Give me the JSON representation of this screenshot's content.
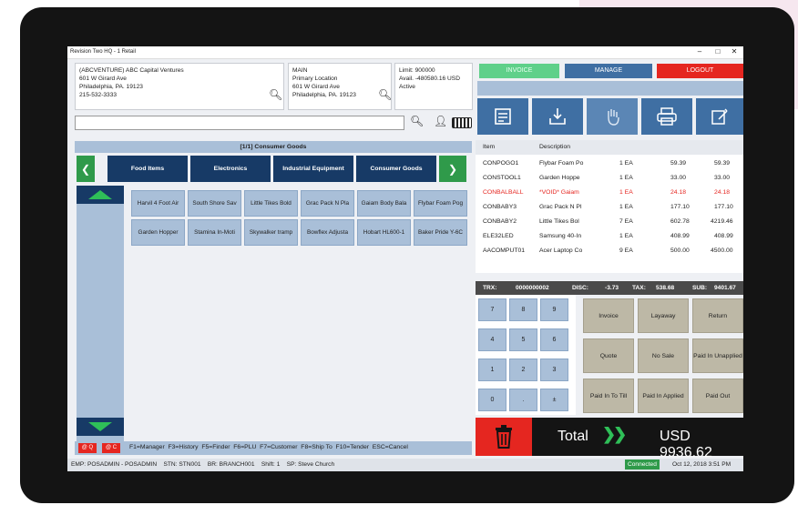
{
  "window": {
    "title": "Revision Two HQ - 1 Retail"
  },
  "customer": {
    "line1": "(ABCVENTURE) ABC Capital Ventures",
    "line2": "601 W Girard Ave",
    "line3": "Philadelphia, PA. 19123",
    "line4": "215-532-3333"
  },
  "location": {
    "line1": "MAIN",
    "line2": "Primary Location",
    "line3": "601 W Girard Ave",
    "line4": "Philadelphia, PA. 19123"
  },
  "credit": {
    "line1": "Limit: 900000",
    "line2": "Avail. -480580.16 USD",
    "line3": "Active"
  },
  "top_buttons": {
    "invoice": "INVOICE",
    "manage": "MANAGE",
    "logout": "LOGOUT"
  },
  "category": {
    "header": "[1/1] Consumer Goods",
    "tabs": [
      "Food Items",
      "Electronics",
      "Industrial Equipment",
      "Consumer Goods"
    ]
  },
  "products": [
    "Harvil 4 Foot Air",
    "South Shore Sav",
    "Little Tikes Bold",
    "Grac Pack N Pla",
    "Gaiam Body Bala",
    "Flybar Foam Pog",
    "Garden Hopper",
    "Stamina In-Moti",
    "Skywalker tramp",
    "Bowflex Adjusta",
    "Hobart HL600-1",
    "Baker Pride Y-6C"
  ],
  "table": {
    "col_item": "Item",
    "col_desc": "Description",
    "rows": [
      {
        "item": "CONPOGO1",
        "desc": "Flybar Foam Po",
        "qty": "1 EA",
        "price": "59.39",
        "total": "59.39"
      },
      {
        "item": "CONSTOOL1",
        "desc": "Garden Hoppe",
        "qty": "1 EA",
        "price": "33.00",
        "total": "33.00"
      },
      {
        "item": "CONBALBALL",
        "desc": "*VOID* Gaiam",
        "qty": "1 EA",
        "price": "24.18",
        "total": "24.18"
      },
      {
        "item": "CONBABY3",
        "desc": "Grac Pack N Pl",
        "qty": "1 EA",
        "price": "177.10",
        "total": "177.10"
      },
      {
        "item": "CONBABY2",
        "desc": "Little Tikes Bol",
        "qty": "7 EA",
        "price": "602.78",
        "total": "4219.46"
      },
      {
        "item": "ELE32LED",
        "desc": "Samsung 40-In",
        "qty": "1 EA",
        "price": "408.99",
        "total": "408.99"
      },
      {
        "item": "AACOMPUT01",
        "desc": "Acer Laptop Co",
        "qty": "9 EA",
        "price": "500.00",
        "total": "4500.00"
      }
    ]
  },
  "summary": {
    "trx_label": "TRX:",
    "trx": "0000000002",
    "disc_label": "DISC:",
    "disc": "-3.73",
    "tax_label": "TAX:",
    "tax": "538.68",
    "sub_label": "SUB:",
    "sub": "9401.67"
  },
  "numpad": [
    "7",
    "8",
    "9",
    "4",
    "5",
    "6",
    "1",
    "2",
    "3",
    "0",
    ".",
    "±"
  ],
  "actions": [
    "Invoice",
    "Layaway",
    "Return",
    "Quote",
    "No Sale",
    "Paid In Unapplied",
    "Paid In To Till",
    "Paid In Applied",
    "Paid Out"
  ],
  "total": {
    "label": "Total",
    "value": "USD 9936.62"
  },
  "shortcuts": "F1=Manager  F3=History  F5=Finder  F6=PLU  F7=Customer  F8=Ship To  F10=Tender  ESC=Cancel",
  "small_buttons": [
    "@ Q",
    "@ C"
  ],
  "status": {
    "text": "EMP: POSADMIN - POSADMIN    STN: STN001    BR: BRANCH001    Shift: 1    SP: Steve Church",
    "connected": "Connected",
    "datetime": "Oct 12, 2018 3:51 PM"
  },
  "colors": {
    "green": "#2f9a4a",
    "navy": "#173a66",
    "red": "#e52620",
    "tile": "#a9bfd8",
    "action": "#bdb8a6"
  }
}
